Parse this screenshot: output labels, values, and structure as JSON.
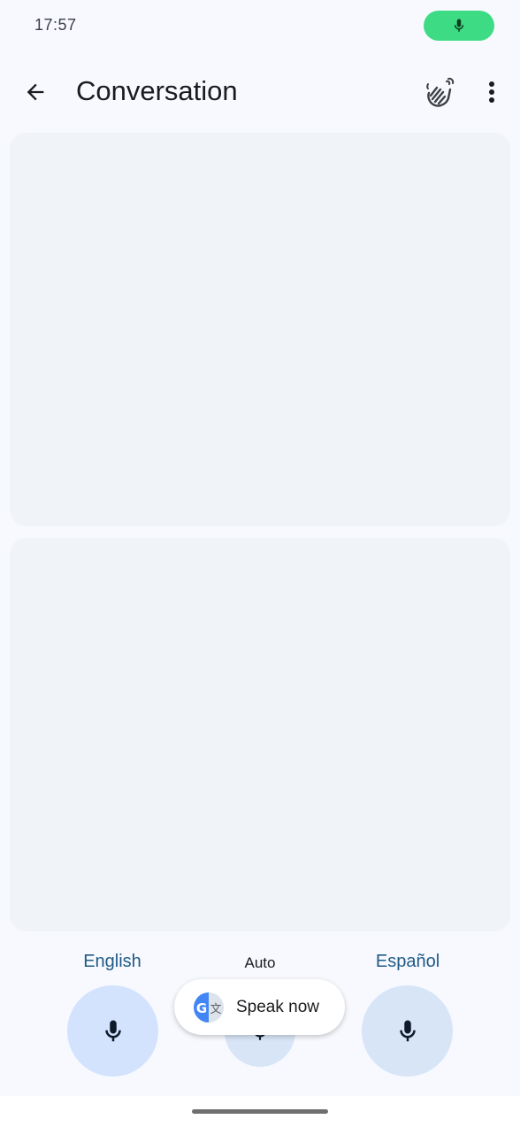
{
  "status_bar": {
    "time": "17:57",
    "icons": [
      "mic-icon"
    ],
    "pill_color": "#3ddc84"
  },
  "app_bar": {
    "title": "Conversation",
    "icons": [
      "back-arrow-icon",
      "wave-hand-icon",
      "more-vert-icon"
    ]
  },
  "languages": {
    "left": "English",
    "center": "Auto",
    "right": "Español"
  },
  "toast": {
    "text": "Speak now",
    "logo_letter": "G",
    "logo_glyph": "文"
  },
  "colors": {
    "accent_text": "#1f5a86",
    "mic_active_bg": "#d3e3fd",
    "mic_bg": "#d8e5f7",
    "panel_bg": "#f0f3f8"
  }
}
